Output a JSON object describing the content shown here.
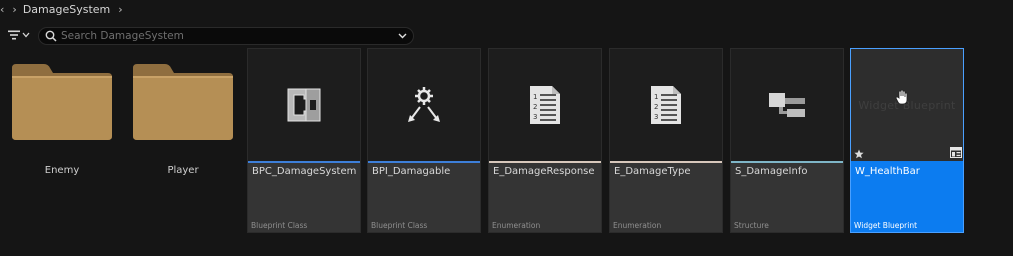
{
  "breadcrumb": {
    "items": [
      "DamageSystem"
    ]
  },
  "search": {
    "placeholder": "Search DamageSystem"
  },
  "folders": [
    {
      "name": "Enemy"
    },
    {
      "name": "Player"
    }
  ],
  "assets": [
    {
      "name": "BPC_DamageSystem",
      "type": "Blueprint Class",
      "icon": "blueprint-component-icon",
      "stripe_color": "#3d7fd9"
    },
    {
      "name": "BPI_Damagable",
      "type": "Blueprint Class",
      "icon": "blueprint-interface-icon",
      "stripe_color": "#3d7fd9"
    },
    {
      "name": "E_DamageResponse",
      "type": "Enumeration",
      "icon": "enumeration-icon",
      "stripe_color": "#d8c8bc"
    },
    {
      "name": "E_DamageType",
      "type": "Enumeration",
      "icon": "enumeration-icon",
      "stripe_color": "#d8c8bc"
    },
    {
      "name": "S_DamageInfo",
      "type": "Structure",
      "icon": "structure-icon",
      "stripe_color": "#7fb6c8"
    },
    {
      "name": "W_HealthBar",
      "type": "Widget Blueprint",
      "icon": "widget-blueprint-icon",
      "stripe_color": "#0c7cf0",
      "selected": true
    }
  ],
  "thumbnail_text": {
    "widget_blueprint": "Widget Blueprint"
  },
  "colors": {
    "selection": "#0c7cf0",
    "folder": "#b58f55",
    "background": "#151515"
  }
}
